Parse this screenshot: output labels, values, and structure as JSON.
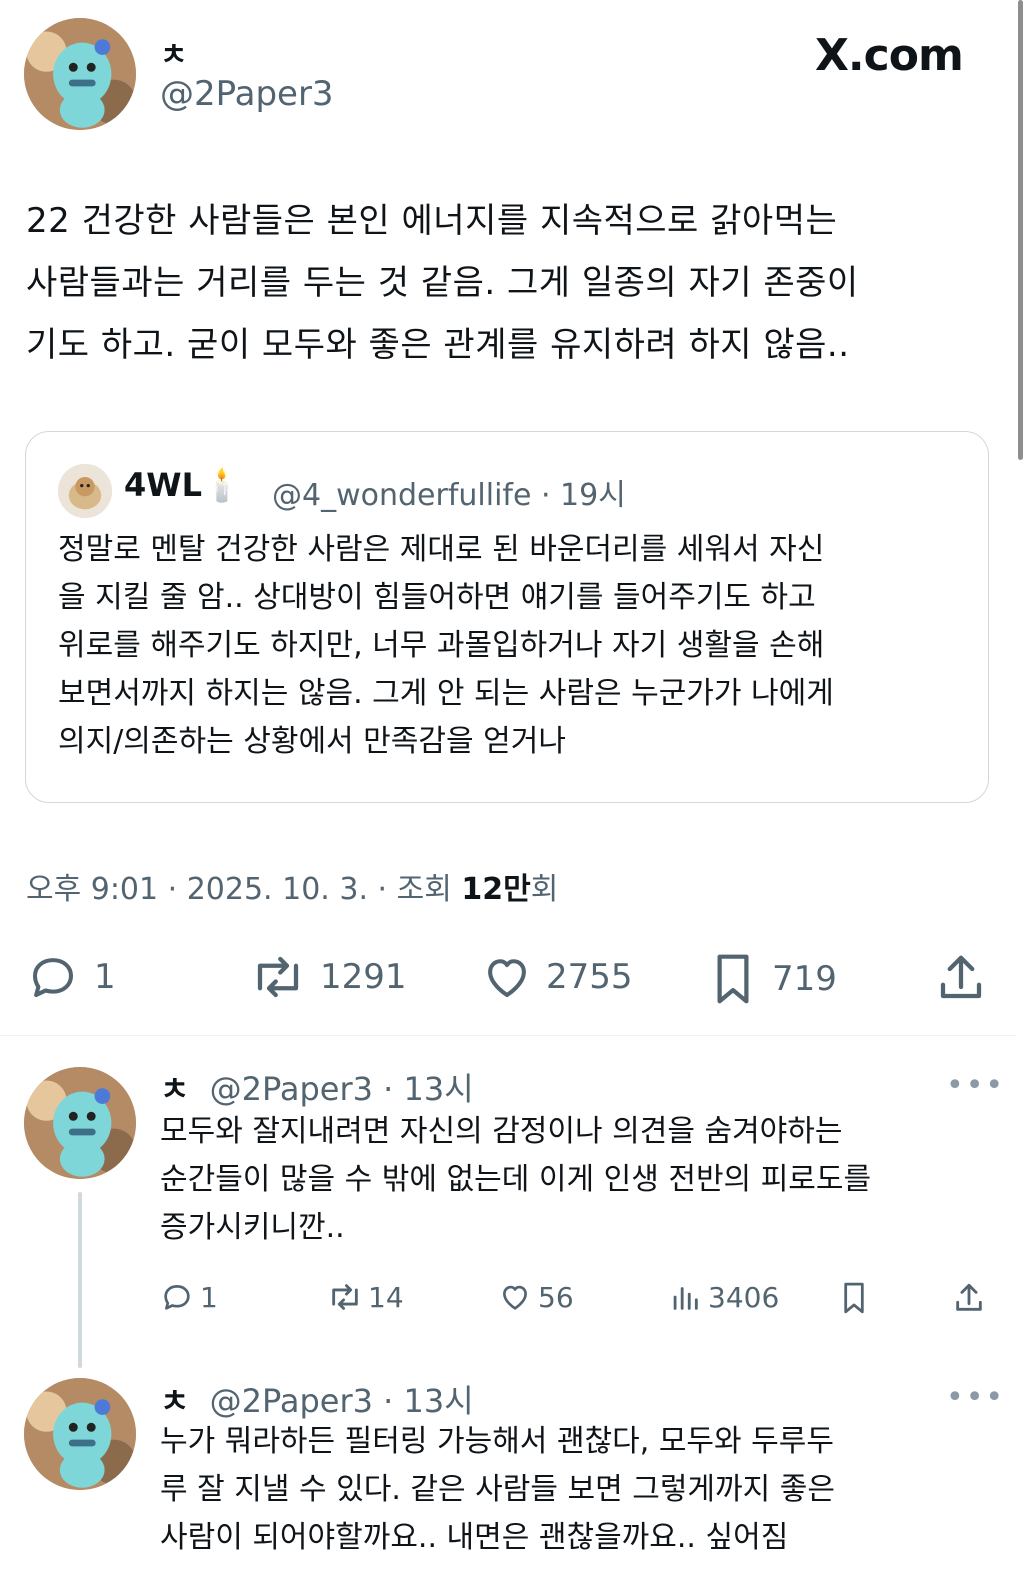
{
  "header": {
    "display_name": "ㅊ",
    "handle": "@2Paper3",
    "site_logo_text": "X.com"
  },
  "main_post": {
    "text_lines": [
      "22 건강한 사람들은 본인 에너지를 지속적으로 갉아먹는",
      "사람들과는 거리를 두는 것 같음. 그게 일종의 자기 존중이",
      "기도 하고. 굳이 모두와 좋은 관계를 유지하려 하지 않음.."
    ],
    "quote": {
      "name": "4WL",
      "emoji": "🕯️",
      "handle": "@4_wonderfullife",
      "time": "· 19시",
      "text_lines": [
        "정말로 멘탈 건강한 사람은 제대로 된 바운더리를 세워서 자신",
        "을 지킬 줄 암.. 상대방이 힘들어하면 얘기를 들어주기도 하고",
        "위로를 해주기도 하지만, 너무 과몰입하거나 자기 생활을 손해",
        "보면서까지 하지는 않음. 그게 안 되는 사람은 누군가가 나에게",
        "의지/의존하는 상황에서 만족감을 얻거나"
      ]
    },
    "meta": {
      "time": "오후 9:01 · 2025. 10. 3. · 조회 ",
      "views": "12만",
      "views_suffix": "회"
    },
    "actions": {
      "replies": "1",
      "reposts": "1291",
      "likes": "2755",
      "bookmarks": "719"
    }
  },
  "replies": [
    {
      "name": "ㅊ",
      "handle": "@2Paper3",
      "time": "· 13시",
      "more": "•••",
      "text_lines": [
        "모두와 잘지내려면 자신의 감정이나 의견을 숨겨야하는",
        "순간들이 많을 수 밖에 없는데 이게 인생 전반의 피로도를",
        "증가시키니깐.."
      ],
      "actions": {
        "replies": "1",
        "reposts": "14",
        "likes": "56",
        "views": "3406"
      }
    },
    {
      "name": "ㅊ",
      "handle": "@2Paper3",
      "time": "· 13시",
      "more": "•••",
      "text_lines": [
        "누가 뭐라하든 필터링 가능해서 괜찮다, 모두와 두루두",
        "루 잘 지낼 수 있다. 같은 사람들 보면 그렇게까지 좋은",
        "사람이 되어야할까요.. 내면은 괜찮을까요.. 싶어짐"
      ]
    }
  ],
  "colors": {
    "text": "#0f1419",
    "secondary": "#536471",
    "border": "#cfd9de",
    "avatar_char": "#6fd3d6"
  },
  "icons": [
    "avatar-plush",
    "x-logo",
    "reply-icon",
    "repost-icon",
    "like-icon",
    "bookmark-icon",
    "share-icon",
    "views-icon",
    "more-icon"
  ]
}
